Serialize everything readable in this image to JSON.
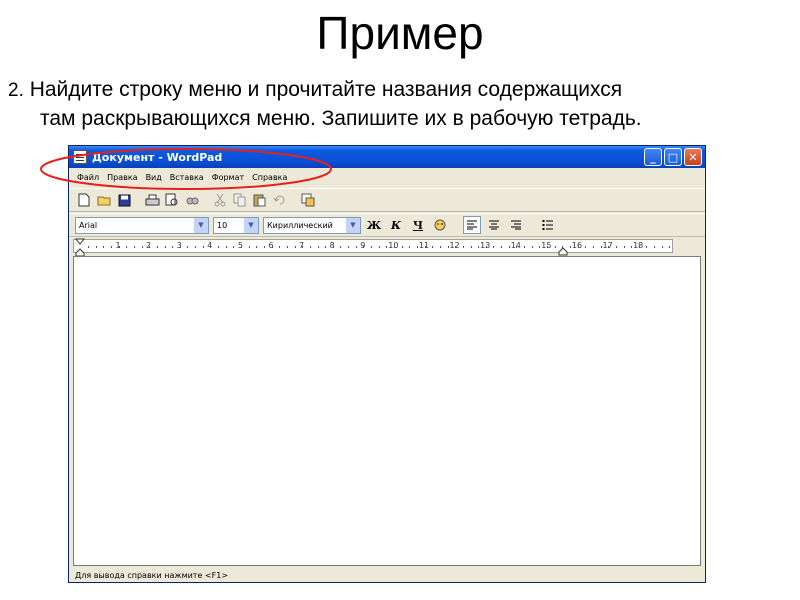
{
  "slide": {
    "title": "Пример",
    "instruction_number": "2.",
    "instruction_line1": " Найдите строку меню и прочитайте названия содержащихся",
    "instruction_line2": "там раскрывающихся меню. Запишите их в рабочую тетрадь."
  },
  "window": {
    "title": "Документ - WordPad",
    "controls": {
      "minimize": "_",
      "maximize": "□",
      "close": "✕"
    },
    "menu": [
      "Файл",
      "Правка",
      "Вид",
      "Вставка",
      "Формат",
      "Справка"
    ],
    "toolbar_icons": [
      "new-icon",
      "open-icon",
      "save-icon",
      "print-icon",
      "print-preview-icon",
      "find-icon",
      "cut-icon",
      "copy-icon",
      "paste-icon",
      "undo-icon",
      "insert-date-icon"
    ],
    "format": {
      "font": "Arial",
      "size": "10",
      "script": "Кириллический",
      "bold": "Ж",
      "italic": "К",
      "underline": "Ч"
    },
    "ruler_numbers": [
      "1",
      "2",
      "3",
      "4",
      "5",
      "6",
      "7",
      "8",
      "9",
      "10",
      "11",
      "12",
      "13",
      "14",
      "15",
      "16",
      "17",
      "18"
    ],
    "status_text": "Для вывода справки нажмите <F1>"
  },
  "colors": {
    "titlebar": "#0a4fd6",
    "window_bg": "#ece9d8",
    "highlight": "#e8201c",
    "close_button": "#c9401c"
  }
}
